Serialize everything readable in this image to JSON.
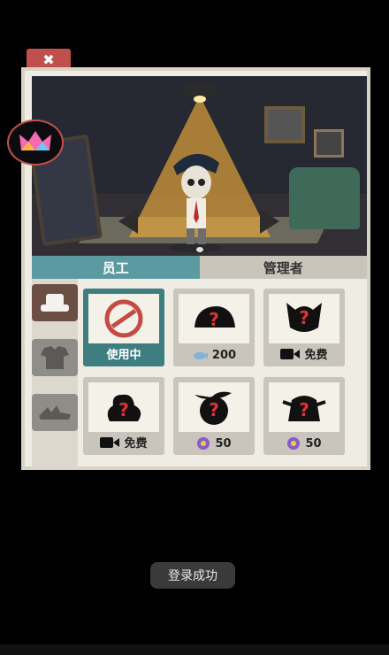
{
  "panel": {
    "tabs": [
      {
        "label": "员工",
        "active": true
      },
      {
        "label": "管理者",
        "active": false
      }
    ],
    "side_categories": [
      "hat",
      "shirt",
      "shoes"
    ],
    "items": [
      {
        "label": "使用中",
        "icon": "no-entry-icon",
        "selected": true
      },
      {
        "label": "200",
        "icon": "fish-icon",
        "selected": false
      },
      {
        "label": "免费",
        "icon": "video-icon",
        "selected": false
      },
      {
        "label": "免费",
        "icon": "video-icon",
        "selected": false
      },
      {
        "label": "50",
        "icon": "gem-icon",
        "selected": false
      },
      {
        "label": "50",
        "icon": "gem-icon",
        "selected": false
      }
    ]
  },
  "toast": "登录成功",
  "colors": {
    "accent": "#5b9aa1",
    "selected_card": "#3e7e80",
    "close": "#c0504d"
  }
}
